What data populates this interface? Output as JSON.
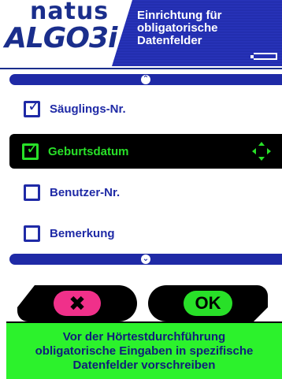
{
  "header": {
    "logo_top": "natus",
    "logo_bottom": "ALGO3i",
    "title_line1": "Einrichtung für",
    "title_line2": "obligatorische",
    "title_line3": "Datenfelder"
  },
  "list": {
    "scroll_up_icon": "chevron-up-icon",
    "scroll_down_icon": "chevron-down-icon",
    "items": [
      {
        "label": "Säuglings-Nr.",
        "checked": true,
        "selected": false
      },
      {
        "label": "Geburtsdatum",
        "checked": true,
        "selected": true
      },
      {
        "label": "Benutzer-Nr.",
        "checked": false,
        "selected": false
      },
      {
        "label": "Bemerkung",
        "checked": false,
        "selected": false
      }
    ]
  },
  "buttons": {
    "cancel_symbol": "✖",
    "ok_label": "OK"
  },
  "info": {
    "line1": "Vor der Hörtestdurchführung",
    "line2": "obligatorische Eingaben in spezifische",
    "line3": "Datenfelder vorschreiben"
  },
  "colors": {
    "brand_blue": "#1f2aa6",
    "selection_green": "#28e028",
    "cancel_pink": "#f0308a",
    "info_green": "#2cf22c"
  }
}
